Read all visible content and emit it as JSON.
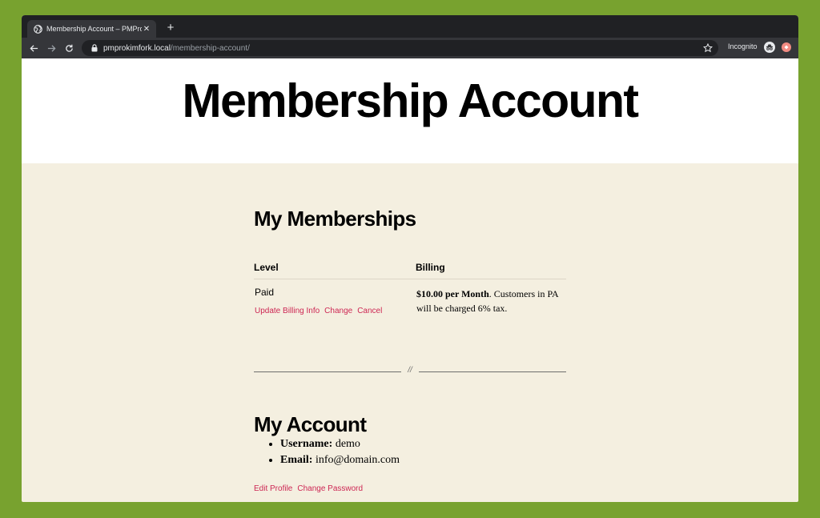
{
  "browser": {
    "tab_title": "Membership Account – PMPro",
    "close_glyph": "✕",
    "newtab_glyph": "+",
    "url_host": "pmprokimfork.local",
    "url_path": "/membership-account/",
    "incognito_label": "Incognito"
  },
  "page": {
    "title": "Membership Account",
    "memberships": {
      "heading": "My Memberships",
      "col_level": "Level",
      "col_billing": "Billing",
      "level_name": "Paid",
      "actions": [
        "Update Billing Info",
        "Change",
        "Cancel"
      ],
      "billing_price": "$10.00 per Month",
      "billing_note": ". Customers in PA will be charged 6% tax."
    },
    "separator": "//",
    "account": {
      "heading": "My Account",
      "username_label": "Username:",
      "username_value": " demo",
      "email_label": "Email:",
      "email_value": " info@domain.com",
      "actions": [
        "Edit Profile",
        "Change Password"
      ]
    }
  },
  "colors": {
    "frame": "#78a22f",
    "page_bg": "#f4efe0",
    "link": "#cd2653"
  }
}
